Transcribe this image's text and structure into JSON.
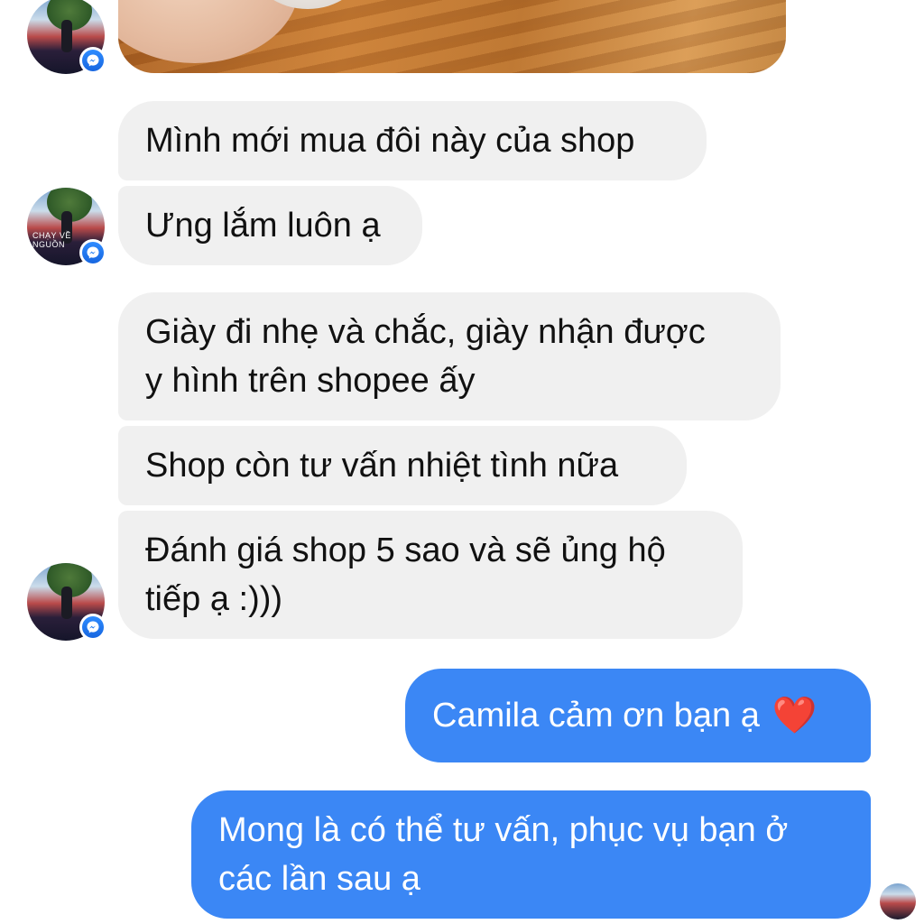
{
  "messages": {
    "in": [
      "Mình mới mua đôi này của shop",
      "Ưng lắm luôn ạ",
      "Giày đi nhẹ và chắc, giày nhận được",
      "y hình trên shopee ấy",
      "Shop còn tư vấn nhiệt tình nữa",
      "Đánh giá shop 5 sao và sẽ ủng hộ",
      "tiếp ạ :)))"
    ],
    "out": [
      "Camila cảm ơn bạn ạ",
      "Mong là có thể tư vấn, phục vụ bạn ở",
      "các lần sau ạ"
    ],
    "heart": "❤️"
  },
  "avatar": {
    "caption_line1": "CHẠY VỀ",
    "caption_line2": "NGUỒN"
  },
  "colors": {
    "incoming_bubble": "#f0f0f0",
    "outgoing_bubble": "#3b87f5",
    "messenger_badge": "#1f7bf2"
  },
  "icons": {
    "badge": "messenger-icon",
    "photo": "shoe-photo"
  }
}
